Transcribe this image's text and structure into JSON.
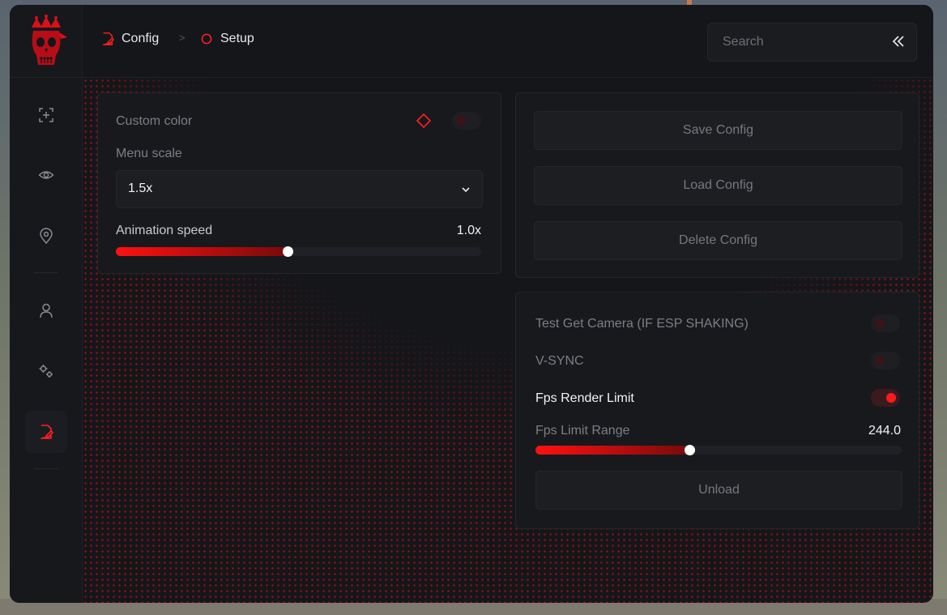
{
  "breadcrumb": {
    "items": [
      {
        "label": "Config",
        "icon": "config-icon"
      },
      {
        "label": "Setup",
        "icon": "circle-icon"
      }
    ],
    "separator": ">"
  },
  "search": {
    "placeholder": "Search"
  },
  "sidebar": {
    "items": [
      {
        "name": "aim",
        "icon": "crosshair-icon"
      },
      {
        "name": "visuals",
        "icon": "eye-icon"
      },
      {
        "name": "locations",
        "icon": "map-pin-icon"
      },
      {
        "name": "player",
        "icon": "user-icon"
      },
      {
        "name": "misc",
        "icon": "gears-icon"
      },
      {
        "name": "config",
        "icon": "config-icon",
        "active": true
      }
    ]
  },
  "menu_panel": {
    "custom_color_label": "Custom color",
    "custom_color_enabled": false,
    "menu_scale_label": "Menu scale",
    "menu_scale_value": "1.5x",
    "animation_speed_label": "Animation speed",
    "animation_speed_value": "1.0x",
    "animation_speed_fraction": 0.47
  },
  "config_panel": {
    "save": "Save Config",
    "load": "Load Config",
    "delete": "Delete Config"
  },
  "settings_panel": {
    "test_camera_label": "Test Get Camera (IF ESP SHAKING)",
    "test_camera_enabled": false,
    "vsync_label": "V-SYNC",
    "vsync_enabled": false,
    "fps_render_limit_label": "Fps Render Limit",
    "fps_render_limit_enabled": true,
    "fps_limit_range_label": "Fps Limit Range",
    "fps_limit_range_value": "244.0",
    "fps_limit_fraction": 0.42,
    "unload": "Unload"
  },
  "colors": {
    "accent": "#ff1a1a",
    "background": "#15161a",
    "panel": "#18191d"
  }
}
